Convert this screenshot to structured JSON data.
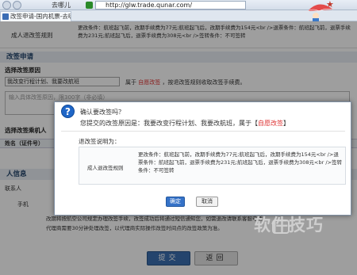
{
  "browser": {
    "url": "http://glw.trade.qunar.com/",
    "qunar_tab": "去哪儿",
    "tabs": [
      {
        "label": "改签申请-国内机票-去哪儿"
      },
      {
        "label": "去哪儿"
      }
    ]
  },
  "page": {
    "rule_label": "成人退改签规则",
    "rule_text": "更改条件：航班起飞前，改期手续费为77元;航班起飞后，改期手续费为154元<br />退票条件：航班起飞前，退票手续费为231元;航班起飞后，退票手续费为308元<br />签转条件：不可签转",
    "section_apply": "改签申请",
    "section_reason": "选择改签原因",
    "reason_select": "我改变行程计划、我要改航班",
    "reason_hint_prefix": "属于",
    "reason_hint_tag": "自愿改签",
    "reason_hint_suffix": "，按退改签规则收取改签手续费。",
    "reason_placeholder": "输入具体改签原因，限300字（非必填）",
    "section_passenger": "选择改签乘机人",
    "passenger_col": "姓名（证件号）",
    "section_contact": "人信息",
    "contact_label": "联系人",
    "phone_label": "手机",
    "notice_line1": "改期将按航空公司规定办理改签手续，改签成功后将通过短信通知您，如需退改请联系客服电话",
    "notice_line2": "代理商需要30分钟处理改签，以代理商实际操作改签时间点的改签政策为准。",
    "submit_label": "提交",
    "back_label": "返回"
  },
  "dialog": {
    "title": "确认要改签吗？",
    "reason_prefix": "您提交的改签原因是：我要改变行程计划、我要改航班，属于【",
    "reason_tag": "自愿改签",
    "reason_suffix": "】",
    "explain_label": "退改签说明为：",
    "rule_label": "成人退改签规则",
    "rule_text": "更改条件：航班起飞前，改期手续费为77元;航班起飞后，改期手续费为154元<br />退票条件：航班起飞前，退票手续费为231元;航班起飞后，退票手续费为308元<br />签转条件：不可签转",
    "ok_label": "确定",
    "cancel_label": "取消"
  },
  "watermark": {
    "text": "软件技巧"
  },
  "colors": {
    "accent": "#3572c8",
    "highlight": "#d33333",
    "section_bg": "#e9eef4"
  }
}
